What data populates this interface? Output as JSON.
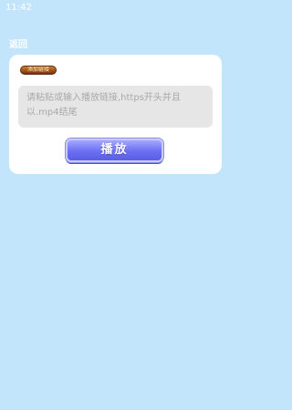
{
  "status_bar": {
    "time": "11:42"
  },
  "header": {
    "back_label": "返回"
  },
  "card": {
    "add_link_label": "添加链接",
    "url_input": {
      "value": "",
      "placeholder": "请粘贴或输入播放链接,https开头并且以.mp4结尾"
    },
    "play_label": "播放"
  },
  "colors": {
    "background": "#c2e5fb",
    "card": "#ffffff",
    "input_bg": "#e6e6e6",
    "play_button": "#6b6ff2",
    "chip": "#7a2e14"
  }
}
